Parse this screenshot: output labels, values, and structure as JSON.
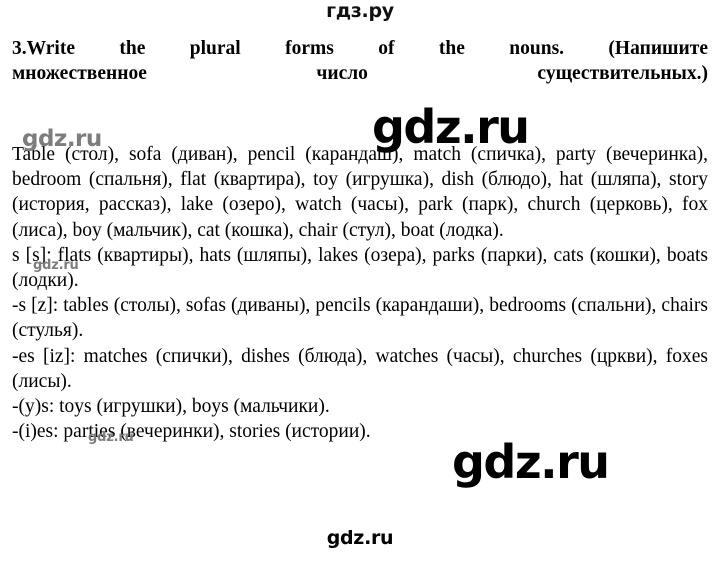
{
  "site": {
    "header_logo": "гдз.ру",
    "footer_logo": "gdz.ru"
  },
  "watermarks": {
    "wm_a": "gdz.ru",
    "wm_b": "gdz.ru",
    "wm_c": "gdz.ru",
    "wm_d": "gdz.ru",
    "wm_e": "gdz.ru"
  },
  "exercise": {
    "number": "3.",
    "title_line_1": "3.Write the plural forms of the nouns. (Напишите",
    "title_line_2": "множественное число существительных.)",
    "title_full": "3.Write the plural forms of the nouns. (Напишите множественное число существительных.)"
  },
  "answer": {
    "paragraphs": [
      "Table (стол), sofa (диван), pencil (карандаш), match (спичка), party (вечеринка), bedroom (спальня), flat (квартира), toy (игрушка), dish (блюдо), hat (шляпа), story (история, рассказ), lake (озеро), watch (часы), park (парк), church (церковь), fox (лиса), boy (мальчик), cat (кошка), chair (стул), boat (лодка).",
      "s [s]: flats (квартиры), hats (шляпы), lakes (озера), parks (парки), cats (кошки), boats (лодки).",
      "-s [z]: tables (столы), sofas (диваны), pencils (карандаши), bedrooms (спальни), chairs (стулья).",
      "-es [iz]: matches (спички), dishes (блюда), watches (часы), churches (цркви), foxes (лисы).",
      "-(y)s: toys (игрушки), boys (мальчики).",
      "-(i)es: parties (вечеринки), stories (истории)."
    ]
  }
}
